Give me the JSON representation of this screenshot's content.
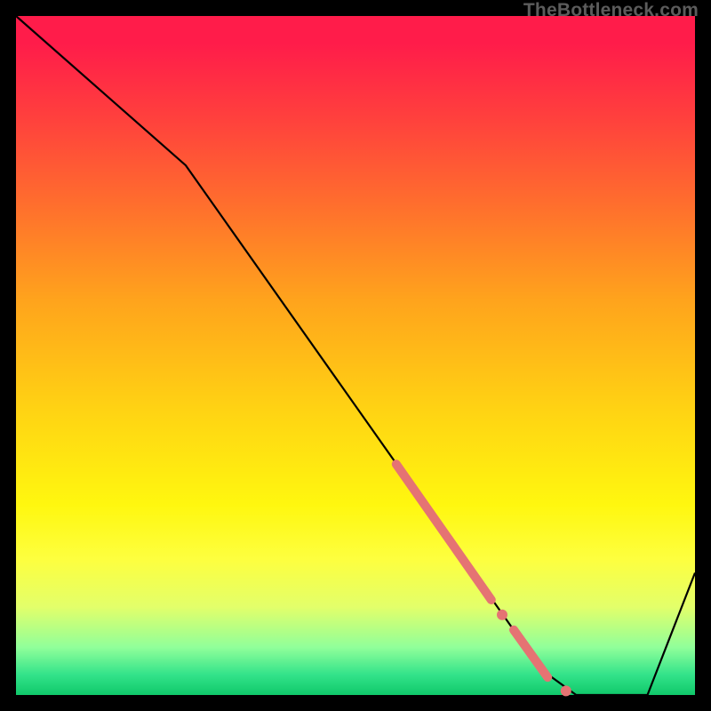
{
  "watermark": "TheBottleneck.com",
  "chart_data": {
    "type": "line",
    "title": "",
    "xlabel": "",
    "ylabel": "",
    "xlim": [
      0,
      100
    ],
    "ylim": [
      0,
      100
    ],
    "grid": false,
    "legend": false,
    "series": [
      {
        "name": "curve",
        "stroke": "#000000",
        "x": [
          0,
          25,
          73,
          77,
          82.5,
          84,
          93,
          100
        ],
        "values": [
          100,
          78,
          10,
          4,
          0,
          0,
          0,
          18
        ]
      }
    ],
    "markers": [
      {
        "name": "highlight-segment",
        "type": "thick-stroke",
        "color": "#e57373",
        "width": 10,
        "x": [
          56,
          70
        ],
        "values": [
          34,
          14
        ]
      },
      {
        "name": "dot-1",
        "type": "dot",
        "color": "#e57373",
        "radius": 6,
        "x": 71.6,
        "value": 11.8
      },
      {
        "name": "gap-segment",
        "type": "thick-stroke",
        "color": "#e57373",
        "width": 10,
        "x": [
          73.3,
          78.3
        ],
        "values": [
          9.6,
          2.6
        ]
      },
      {
        "name": "dot-2",
        "type": "dot",
        "color": "#e57373",
        "radius": 6,
        "x": 81,
        "value": 0.6
      }
    ],
    "background_gradient": {
      "top_color": "#ff1c4a",
      "mid_color": "#fff70f",
      "bottom_color": "#10c86a"
    }
  }
}
